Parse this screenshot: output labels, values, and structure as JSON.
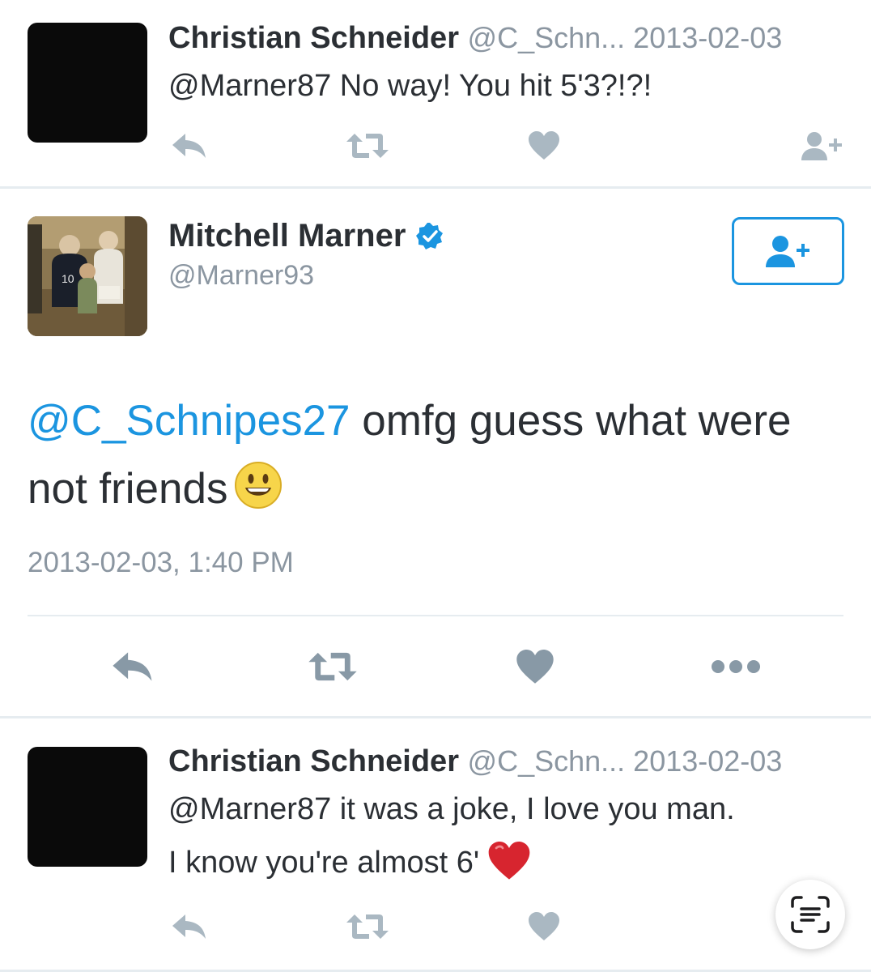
{
  "tweets": [
    {
      "name": "Christian Schneider",
      "meta": "@C_Schn... 2013-02-03",
      "text": "@Marner87 No way! You hit 5'3?!?!"
    },
    {
      "name": "Mitchell Marner",
      "handle": "@Marner93",
      "mention": "@C_Schnipes27",
      "text": " omfg guess what were not friends",
      "timestamp": "2013-02-03, 1:40 PM"
    },
    {
      "name": "Christian Schneider",
      "meta": "@C_Schn... 2013-02-03",
      "text_line1": "@Marner87 it was a joke, I love you man.",
      "text_line2": "I know you're almost 6'"
    }
  ],
  "icons": {
    "reply": "reply-icon",
    "retweet": "retweet-icon",
    "like": "heart-icon",
    "follow": "follow-icon",
    "more": "more-icon",
    "verified": "verified-badge-icon",
    "scan": "scan-text-icon"
  },
  "colors": {
    "accent": "#1b95e0",
    "icon_gray": "#aab8c2",
    "meta_gray": "#8b96a1",
    "text": "#2b2f34",
    "divider": "#e6ecf0"
  }
}
